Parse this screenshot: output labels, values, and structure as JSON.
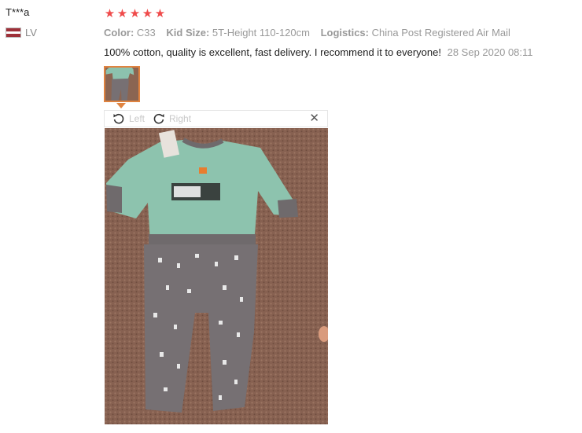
{
  "review": {
    "reviewer_name": "T***a",
    "country_code": "LV",
    "rating": 5,
    "attributes": [
      {
        "key": "Color:",
        "value": "C33"
      },
      {
        "key": "Kid Size:",
        "value": "5T-Height 110-120cm"
      },
      {
        "key": "Logistics:",
        "value": "China Post Registered Air Mail"
      }
    ],
    "text": "100% cotton, quality is excellent, fast delivery. I recommend it to everyone!",
    "date": "28 Sep 2020 08:11"
  },
  "viewer": {
    "rotate_left_label": "Left",
    "rotate_right_label": "Right",
    "close_glyph": "✕"
  },
  "icons": {
    "star": "star-icon",
    "rotate_left": "rotate-left-icon",
    "rotate_right": "rotate-right-icon",
    "close": "close-icon"
  },
  "colors": {
    "star": "#ef4b4b",
    "thumb_border": "#e08340",
    "muted_text": "#999999"
  }
}
